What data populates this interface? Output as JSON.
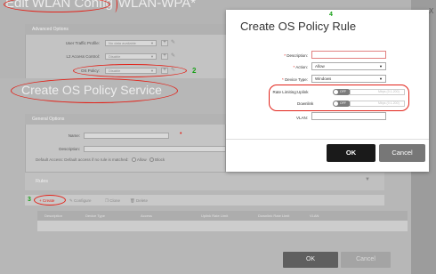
{
  "wlan": {
    "title": "Edit WLAN Config",
    "subtitle": "WLAN-WPA*",
    "advanced": {
      "title": "Advanced Options",
      "rows": [
        {
          "label": "User Traffic Profile:",
          "value": "No data available"
        },
        {
          "label": "L2 Access Control:",
          "value": "Disable"
        },
        {
          "label": "OS Policy:",
          "value": "Disable"
        }
      ]
    }
  },
  "service": {
    "title": "Create OS Policy Service",
    "general": {
      "title": "General Options",
      "name_label": "Name:",
      "description_label": "Description:",
      "default_action": "Default Access: Default access if no rule is matched:",
      "allow": "Allow",
      "block": "Block"
    },
    "rules": {
      "title": "Rules",
      "toolbar": [
        "Create",
        "Configure",
        "Clone",
        "Delete"
      ],
      "columns": [
        "Description",
        "Device Type",
        "Access",
        "Uplink Rate Limit",
        "Downlink Rate Limit",
        "VLAN"
      ]
    },
    "ok": "OK",
    "cancel": "Cancel"
  },
  "dialog": {
    "title": "Create OS Policy Rule",
    "description_label": "Description:",
    "description_value": "",
    "action_label": "Action:",
    "action_value": "Allow",
    "device_type_label": "Device Type:",
    "device_type_value": "Windows",
    "rate_limiting_label": "Rate Limiting:",
    "uplink_label": "Uplink",
    "downlink_label": "Downlink",
    "uplink_toggle": "OFF",
    "downlink_toggle": "OFF",
    "uplink_placeholder": "Mbps (0.1-200)",
    "downlink_placeholder": "Mbps (0.1-200)",
    "vlan_label": "VLAN:",
    "vlan_value": "",
    "ok": "OK",
    "cancel": "Cancel",
    "close": "X"
  },
  "annotations": {
    "step2": "2",
    "step3": "3",
    "step4": "4"
  },
  "colors": {
    "highlight": "#e2231a",
    "step_number": "#18a018",
    "ok_button": "#1a1a1a"
  }
}
